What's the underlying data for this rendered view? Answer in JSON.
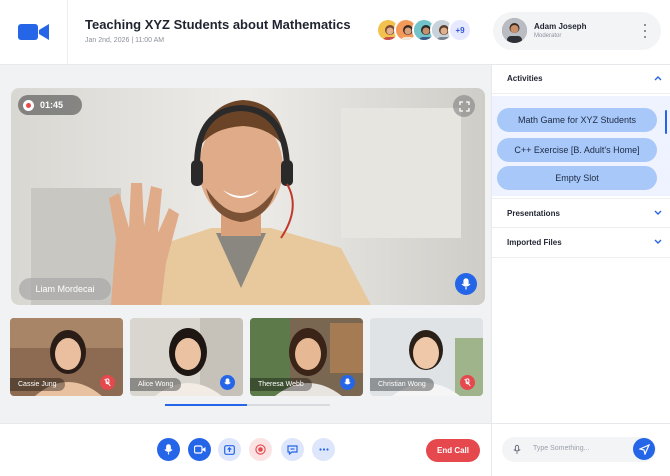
{
  "header": {
    "title": "Teaching XYZ Students about Mathematics",
    "date": "Jan 2nd, 2026 | 11:00 AM",
    "more_participants": "+9"
  },
  "user": {
    "name": "Adam Joseph",
    "role": "Moderator"
  },
  "main_video": {
    "timer": "01:45",
    "speaker": "Liam Mordecai"
  },
  "participants": [
    {
      "name": "Cassie Jung",
      "mic": "muted"
    },
    {
      "name": "Alice Wong",
      "mic": "on"
    },
    {
      "name": "Theresa Webb",
      "mic": "on"
    },
    {
      "name": "Christian Wong",
      "mic": "muted"
    }
  ],
  "toolbar": {
    "end_call": "End Call"
  },
  "sidebar": {
    "activities": {
      "title": "Activities",
      "items": [
        "Math Game for XYZ Students",
        "C++ Exercise [B. Adult's Home]",
        "Empty Slot"
      ]
    },
    "presentations": "Presentations",
    "imported_files": "Imported Files"
  },
  "chat": {
    "placeholder": "Type Something..."
  },
  "colors": {
    "accent": "#2566e8",
    "danger": "#e5484d",
    "chip": "#a8c8f9"
  }
}
